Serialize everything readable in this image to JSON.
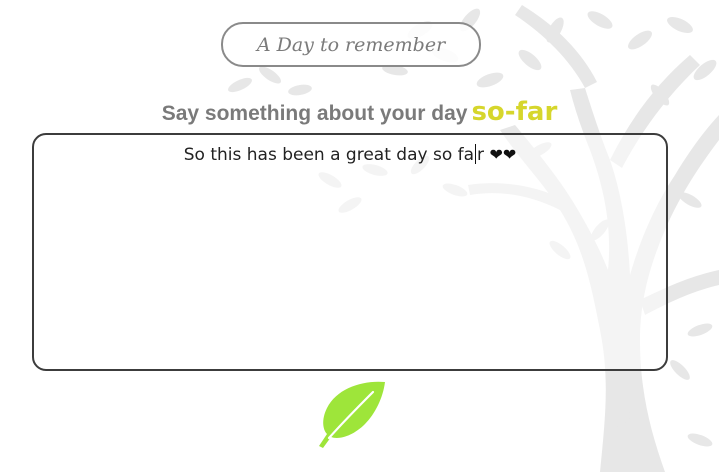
{
  "header": {
    "title_button": "A Day to remember"
  },
  "prompt": {
    "main": "Say something about your day",
    "accent": "so-far",
    "accent_color": "#d6d62c"
  },
  "entry": {
    "text_before_caret": "So this has been a great day so fa",
    "text_after_caret": "r",
    "hearts": "❤❤"
  },
  "submit": {
    "icon": "feather-icon",
    "color": "#9ee53a"
  }
}
